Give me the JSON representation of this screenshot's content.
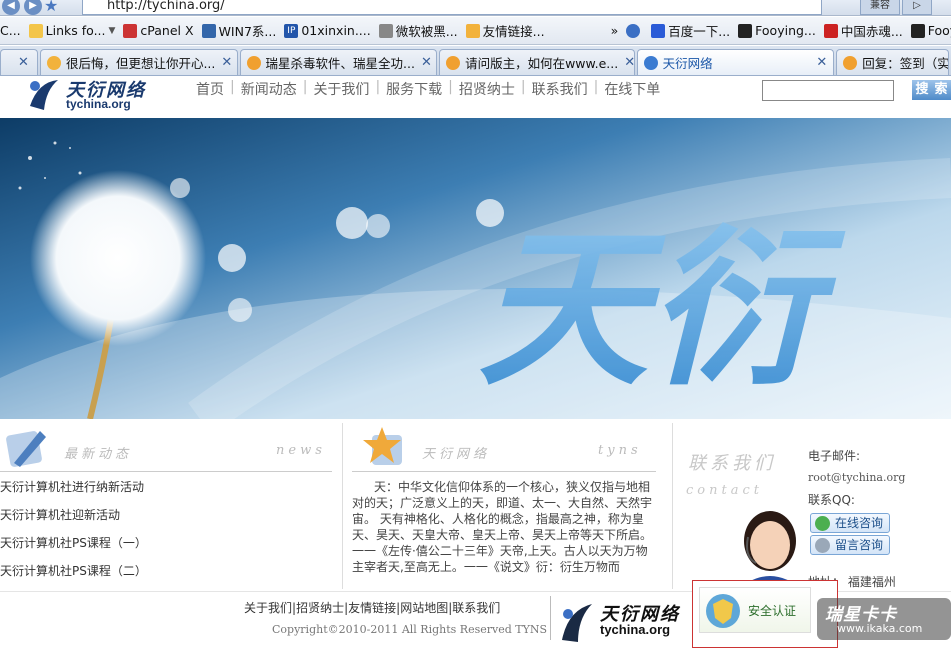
{
  "browser": {
    "url": "http://tychina.org/",
    "addr_right_btn": "兼容",
    "bookmarks": [
      {
        "label": "Links fo...",
        "color": "#f3c54a"
      },
      {
        "label": "cPanel X",
        "color": "#cc3333"
      },
      {
        "label": "WIN7系...",
        "color": "#3366aa"
      },
      {
        "label": "01xinxin....",
        "color": "#2255aa"
      },
      {
        "label": "微软被黑...",
        "color": "#888888"
      },
      {
        "label": "友情链接...",
        "color": "#f2b23c"
      },
      {
        "label": "百度一下...",
        "color": "#2a5bd7"
      },
      {
        "label": "Fooying...",
        "color": "#222222"
      },
      {
        "label": "中国赤魂...",
        "color": "#cc2222"
      },
      {
        "label": "Fooyin",
        "color": "#222222"
      }
    ],
    "bookmark_prefix": "C...",
    "tabs": [
      {
        "label": "很后悔，但更想让你开心...",
        "color": "#f2b23c"
      },
      {
        "label": "瑞星杀毒软件、瑞星全功...",
        "color": "#f0a030"
      },
      {
        "label": "请问版主，如何在www.e...",
        "color": "#f0a030"
      },
      {
        "label": "天衍网络",
        "color": "#3b7bd1"
      },
      {
        "label": "回复：签到（实",
        "color": "#f0a030"
      }
    ]
  },
  "site": {
    "logo_cn": "天衍网络",
    "logo_en": "tychina.org",
    "menu": [
      "首页",
      "新闻动态",
      "关于我们",
      "服务下载",
      "招贤纳士",
      "联系我们",
      "在线下单"
    ],
    "search_placeholder": "",
    "search_button": "搜索",
    "banner_text": "天衍",
    "news": {
      "title_cn": "最新动态",
      "title_en": "news",
      "items": [
        "天衍计算机社进行纳新活动",
        "天衍计算机社迎新活动",
        "天衍计算机社PS课程（一）",
        "天衍计算机社PS课程（二）"
      ]
    },
    "about": {
      "title_cn": "天衍网络",
      "title_en": "tyns",
      "text": "天：中华文化信仰体系的一个核心，狭义仅指与地相对的天；广泛意义上的天，即道、太一、大自然、天然宇宙。 天有神格化、人格化的概念，指最高之神，称为皇天、昊天、天皇大帝、皇天上帝、昊天上帝等天下所启。一一《左传·僖公二十三年》天帝,上天。古人以天为万物主宰者天,至高无上。一一《说文》衍：衍生万物而"
    },
    "contact": {
      "title_cn": "联系我们",
      "title_en": "contact",
      "email_label": "电子邮件:",
      "email": "root@tychina.org",
      "qq_label": "联系QQ:",
      "btn_online": "在线咨询",
      "btn_message": "留言咨询",
      "address_label": "地址：",
      "address": "福建福州"
    },
    "footer": {
      "links": [
        "关于我们",
        "招贤纳士",
        "友情链接",
        "网站地图",
        "联系我们"
      ],
      "copyright": "Copyright©2010-2011 All Rights Reserved TYNS",
      "cert": "安全认证"
    },
    "watermark_cn": "瑞星卡卡",
    "watermark_en": "www.ikaka.com"
  }
}
